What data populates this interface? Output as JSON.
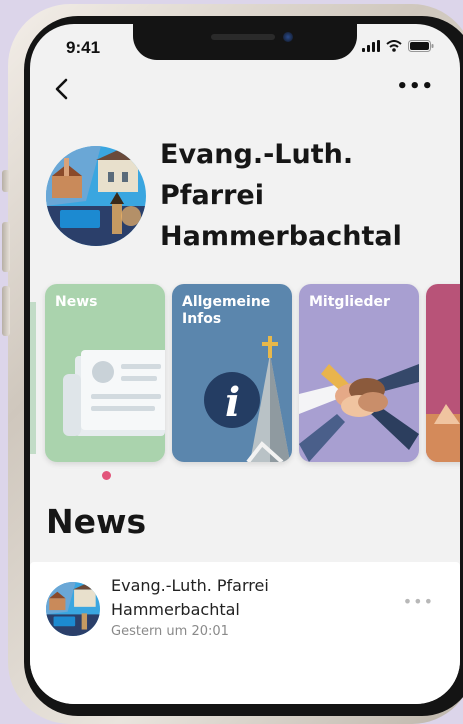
{
  "status_bar": {
    "time": "9:41"
  },
  "header": {
    "title": "Evang.-Luth. Pfarrei Hammerbachtal"
  },
  "tiles": [
    {
      "label": "News",
      "color": "#aad3ad"
    },
    {
      "label": "Allgemeine Infos",
      "color": "#5b86ad"
    },
    {
      "label": "Mitglieder",
      "color": "#a89fd1"
    },
    {
      "label": "",
      "color": "#b85378"
    }
  ],
  "logo_text": "Evang.-Luth. Pfarrei Hammerbachtal",
  "feed": {
    "section_title": "News",
    "posts": [
      {
        "author": "Evang.-Luth. Pfarrei Hammerbachtal",
        "time": "Gestern um 20:01"
      }
    ]
  },
  "colors": {
    "accent": "#e2547a",
    "background": "#f2f2f2"
  }
}
